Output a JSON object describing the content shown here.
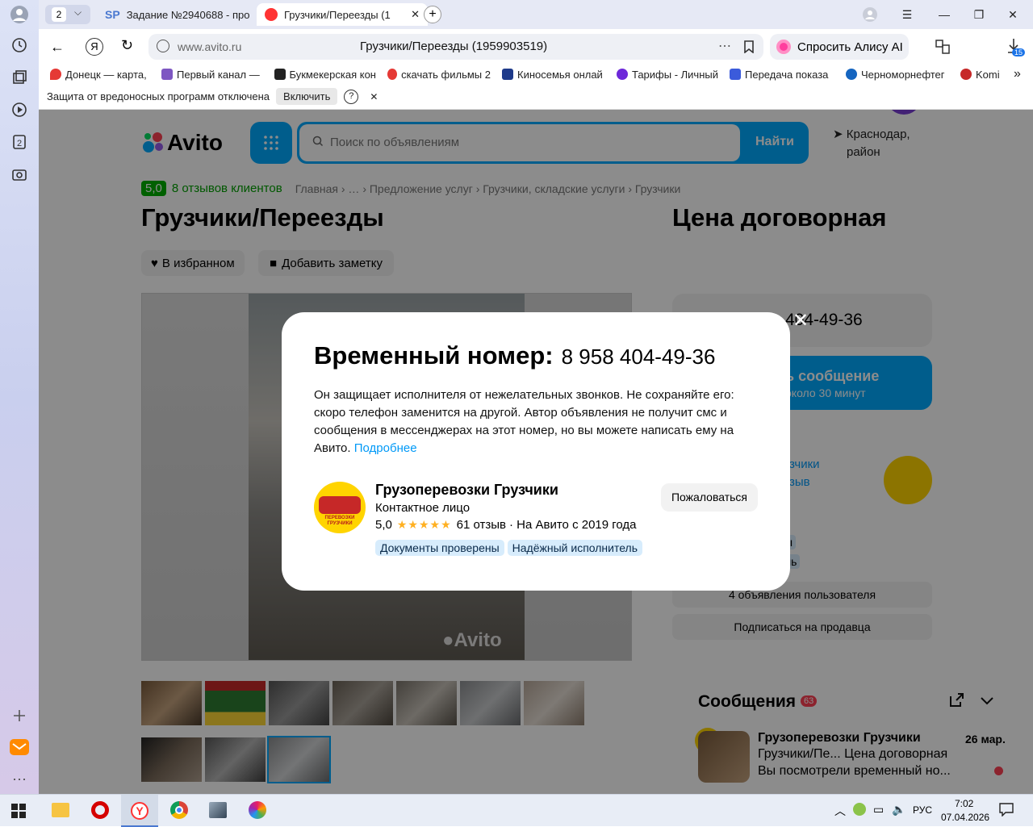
{
  "browser": {
    "tab_counter": "2",
    "tabs": [
      {
        "label": "Задание №2940688 - про"
      },
      {
        "label": "Грузчики/Переезды (1"
      }
    ],
    "address_host": "www.avito.ru",
    "page_title": "Грузчики/Переезды (1959903519)",
    "alice_label": "Спросить Алису AI",
    "downloads_badge": "15",
    "bookmarks": [
      {
        "label": "Донецк — карта, ",
        "color": "#e53935"
      },
      {
        "label": "Первый канал — ",
        "color": "#7e57c2"
      },
      {
        "label": "Букмекерская кон",
        "color": "#222222"
      },
      {
        "label": "скачать фильмы 2",
        "color": "#e53935"
      },
      {
        "label": "Киносемья онлай",
        "color": "#1e3a8a"
      },
      {
        "label": "Тарифы - Личный",
        "color": "#6d28d9"
      },
      {
        "label": "Передача показа",
        "color": "#3b5bdb"
      },
      {
        "label": "Черноморнефтег",
        "color": "#1565c0"
      },
      {
        "label": "Komi",
        "color": "#c62828"
      }
    ],
    "more_bookmarks": "»",
    "infobar_text": "Защита от вредоносных программ отключена",
    "infobar_button": "Включить",
    "infobar_help": "?",
    "infobar_close": "✕"
  },
  "avito": {
    "logo": "Avito",
    "search_placeholder": "Поиск по объявлениям",
    "search_button": "Найти",
    "location_line1": "Краснодар,",
    "location_line2": "район",
    "rating_badge": "5,0",
    "reviews_link": "8 отзывов клиентов",
    "breadcrumbs": "Главная › … › Предложение услуг › Грузчики, складские услуги › Грузчики",
    "title": "Грузчики/Переезды",
    "price": "Цена договорная",
    "fav_button": "В избранном",
    "note_button": "Добавить заметку",
    "phone_partial": "404-49-36",
    "write_button_line1": "ь сообщение",
    "write_button_line2": "около 30 минут",
    "seller_link_partial": "зчики",
    "seller_reviews_partial": "зыв",
    "chip1_partial": "ы",
    "chip2_partial": "ль",
    "user_ads_button": "4 объявления пользователя",
    "subscribe_button": "Подписаться на продавца",
    "watermark": "Avito"
  },
  "messages": {
    "title": "Сообщения",
    "count": "63",
    "sender": "Грузоперевозки Грузчики",
    "date": "26 мар.",
    "subject": "Грузчики/Пе... Цена договорная",
    "preview": "Вы посмотрели временный но..."
  },
  "modal": {
    "heading": "Временный номер:",
    "phone": "8 958 404-49-36",
    "description": "Он защищает исполнителя от нежелательных звонков. Не сохраняйте его: скоро телефон заменится на другой. Автор объявления не получит смс и сообщения в мессенджерах на этот номер, но вы можете написать ему на Авито.",
    "more_link": "Подробнее",
    "seller_name": "Грузоперевозки Грузчики",
    "seller_role": "Контактное лицо",
    "rating": "5,0",
    "stars": 5,
    "reviews": "61 отзыв",
    "since": "· На Авито с 2019 года",
    "badge1": "Документы проверены",
    "badge2": "Надёжный исполнитель",
    "report_button": "Пожаловаться",
    "avatar_text": "ПЕРЕВОЗКИ ГРУЗЧИКИ"
  },
  "taskbar": {
    "lang": "РУС",
    "time": "7:02",
    "date": "07.04.2026"
  },
  "colors": {
    "avito_blue": "#00aaff",
    "avito_green": "#00b000",
    "link_blue": "#0099f7",
    "star": "#ffb021"
  }
}
